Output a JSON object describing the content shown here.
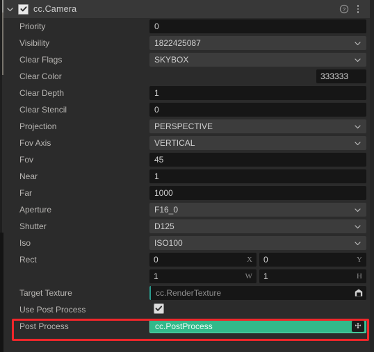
{
  "panel": {
    "component_title": "cc.Camera",
    "enabled_checkbox": true,
    "collapse_icon": "chevron-down-icon",
    "help_icon": "help-circle-icon",
    "menu_icon": "kebab-menu-icon"
  },
  "colors": {
    "panel_bg": "#2b2b2b",
    "header_bg": "#383838",
    "input_bg": "#161616",
    "dropdown_bg": "#3c3c3c",
    "label_text": "#b8b6b3",
    "value_text": "#d4d4d4",
    "accent_green": "#32b98a",
    "accent_cyan": "#2a9d8f",
    "highlight_red": "#f0262a",
    "clear_color_swatch": "#333333"
  },
  "properties": [
    {
      "label": "Priority",
      "kind": "input",
      "value": "0"
    },
    {
      "label": "Visibility",
      "kind": "select",
      "value": "1822425087"
    },
    {
      "label": "Clear Flags",
      "kind": "select",
      "value": "SKYBOX"
    },
    {
      "label": "Clear Color",
      "kind": "color",
      "value": "333333",
      "swatch": "#333333"
    },
    {
      "label": "Clear Depth",
      "kind": "input",
      "value": "1"
    },
    {
      "label": "Clear Stencil",
      "kind": "input",
      "value": "0"
    },
    {
      "label": "Projection",
      "kind": "select",
      "value": "PERSPECTIVE"
    },
    {
      "label": "Fov Axis",
      "kind": "select",
      "value": "VERTICAL"
    },
    {
      "label": "Fov",
      "kind": "input",
      "value": "45"
    },
    {
      "label": "Near",
      "kind": "input",
      "value": "1"
    },
    {
      "label": "Far",
      "kind": "input",
      "value": "1000"
    },
    {
      "label": "Aperture",
      "kind": "select",
      "value": "F16_0"
    },
    {
      "label": "Shutter",
      "kind": "select",
      "value": "D125"
    },
    {
      "label": "Iso",
      "kind": "select",
      "value": "ISO100"
    }
  ],
  "rect": {
    "label": "Rect",
    "x": {
      "value": "0",
      "sub": "X"
    },
    "y": {
      "value": "0",
      "sub": "Y"
    },
    "w": {
      "value": "1",
      "sub": "W"
    },
    "h": {
      "value": "1",
      "sub": "H"
    }
  },
  "target_texture": {
    "label": "Target Texture",
    "placeholder": "cc.RenderTexture",
    "icon": "texture-asset-icon"
  },
  "use_post_process": {
    "label": "Use Post Process",
    "checked": true
  },
  "post_process": {
    "label": "Post Process",
    "value": "cc.PostProcess",
    "icon": "component-puzzle-icon",
    "highlighted": true
  }
}
